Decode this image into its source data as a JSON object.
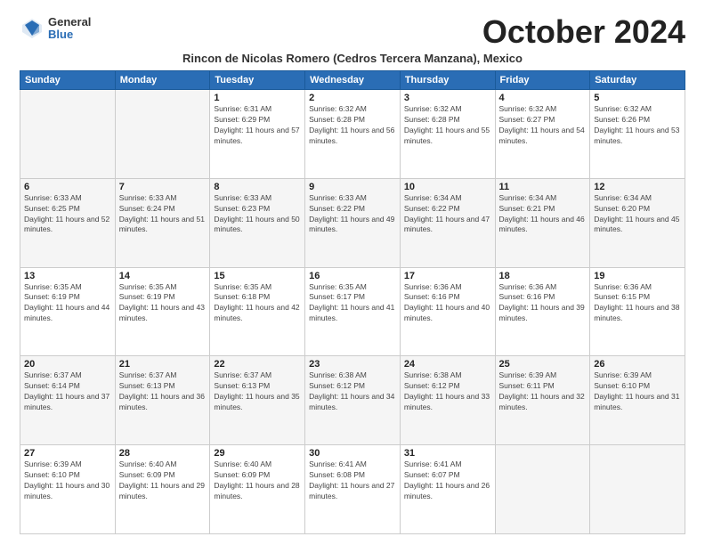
{
  "logo": {
    "general": "General",
    "blue": "Blue"
  },
  "title": "October 2024",
  "location": "Rincon de Nicolas Romero (Cedros Tercera Manzana), Mexico",
  "weekdays": [
    "Sunday",
    "Monday",
    "Tuesday",
    "Wednesday",
    "Thursday",
    "Friday",
    "Saturday"
  ],
  "weeks": [
    [
      {
        "day": "",
        "empty": true
      },
      {
        "day": "",
        "empty": true
      },
      {
        "day": "1",
        "rise": "6:31 AM",
        "set": "6:29 PM",
        "daylight": "11 hours and 57 minutes."
      },
      {
        "day": "2",
        "rise": "6:32 AM",
        "set": "6:28 PM",
        "daylight": "11 hours and 56 minutes."
      },
      {
        "day": "3",
        "rise": "6:32 AM",
        "set": "6:28 PM",
        "daylight": "11 hours and 55 minutes."
      },
      {
        "day": "4",
        "rise": "6:32 AM",
        "set": "6:27 PM",
        "daylight": "11 hours and 54 minutes."
      },
      {
        "day": "5",
        "rise": "6:32 AM",
        "set": "6:26 PM",
        "daylight": "11 hours and 53 minutes."
      }
    ],
    [
      {
        "day": "6",
        "rise": "6:33 AM",
        "set": "6:25 PM",
        "daylight": "11 hours and 52 minutes."
      },
      {
        "day": "7",
        "rise": "6:33 AM",
        "set": "6:24 PM",
        "daylight": "11 hours and 51 minutes."
      },
      {
        "day": "8",
        "rise": "6:33 AM",
        "set": "6:23 PM",
        "daylight": "11 hours and 50 minutes."
      },
      {
        "day": "9",
        "rise": "6:33 AM",
        "set": "6:22 PM",
        "daylight": "11 hours and 49 minutes."
      },
      {
        "day": "10",
        "rise": "6:34 AM",
        "set": "6:22 PM",
        "daylight": "11 hours and 47 minutes."
      },
      {
        "day": "11",
        "rise": "6:34 AM",
        "set": "6:21 PM",
        "daylight": "11 hours and 46 minutes."
      },
      {
        "day": "12",
        "rise": "6:34 AM",
        "set": "6:20 PM",
        "daylight": "11 hours and 45 minutes."
      }
    ],
    [
      {
        "day": "13",
        "rise": "6:35 AM",
        "set": "6:19 PM",
        "daylight": "11 hours and 44 minutes."
      },
      {
        "day": "14",
        "rise": "6:35 AM",
        "set": "6:19 PM",
        "daylight": "11 hours and 43 minutes."
      },
      {
        "day": "15",
        "rise": "6:35 AM",
        "set": "6:18 PM",
        "daylight": "11 hours and 42 minutes."
      },
      {
        "day": "16",
        "rise": "6:35 AM",
        "set": "6:17 PM",
        "daylight": "11 hours and 41 minutes."
      },
      {
        "day": "17",
        "rise": "6:36 AM",
        "set": "6:16 PM",
        "daylight": "11 hours and 40 minutes."
      },
      {
        "day": "18",
        "rise": "6:36 AM",
        "set": "6:16 PM",
        "daylight": "11 hours and 39 minutes."
      },
      {
        "day": "19",
        "rise": "6:36 AM",
        "set": "6:15 PM",
        "daylight": "11 hours and 38 minutes."
      }
    ],
    [
      {
        "day": "20",
        "rise": "6:37 AM",
        "set": "6:14 PM",
        "daylight": "11 hours and 37 minutes."
      },
      {
        "day": "21",
        "rise": "6:37 AM",
        "set": "6:13 PM",
        "daylight": "11 hours and 36 minutes."
      },
      {
        "day": "22",
        "rise": "6:37 AM",
        "set": "6:13 PM",
        "daylight": "11 hours and 35 minutes."
      },
      {
        "day": "23",
        "rise": "6:38 AM",
        "set": "6:12 PM",
        "daylight": "11 hours and 34 minutes."
      },
      {
        "day": "24",
        "rise": "6:38 AM",
        "set": "6:12 PM",
        "daylight": "11 hours and 33 minutes."
      },
      {
        "day": "25",
        "rise": "6:39 AM",
        "set": "6:11 PM",
        "daylight": "11 hours and 32 minutes."
      },
      {
        "day": "26",
        "rise": "6:39 AM",
        "set": "6:10 PM",
        "daylight": "11 hours and 31 minutes."
      }
    ],
    [
      {
        "day": "27",
        "rise": "6:39 AM",
        "set": "6:10 PM",
        "daylight": "11 hours and 30 minutes."
      },
      {
        "day": "28",
        "rise": "6:40 AM",
        "set": "6:09 PM",
        "daylight": "11 hours and 29 minutes."
      },
      {
        "day": "29",
        "rise": "6:40 AM",
        "set": "6:09 PM",
        "daylight": "11 hours and 28 minutes."
      },
      {
        "day": "30",
        "rise": "6:41 AM",
        "set": "6:08 PM",
        "daylight": "11 hours and 27 minutes."
      },
      {
        "day": "31",
        "rise": "6:41 AM",
        "set": "6:07 PM",
        "daylight": "11 hours and 26 minutes."
      },
      {
        "day": "",
        "empty": true
      },
      {
        "day": "",
        "empty": true
      }
    ]
  ]
}
